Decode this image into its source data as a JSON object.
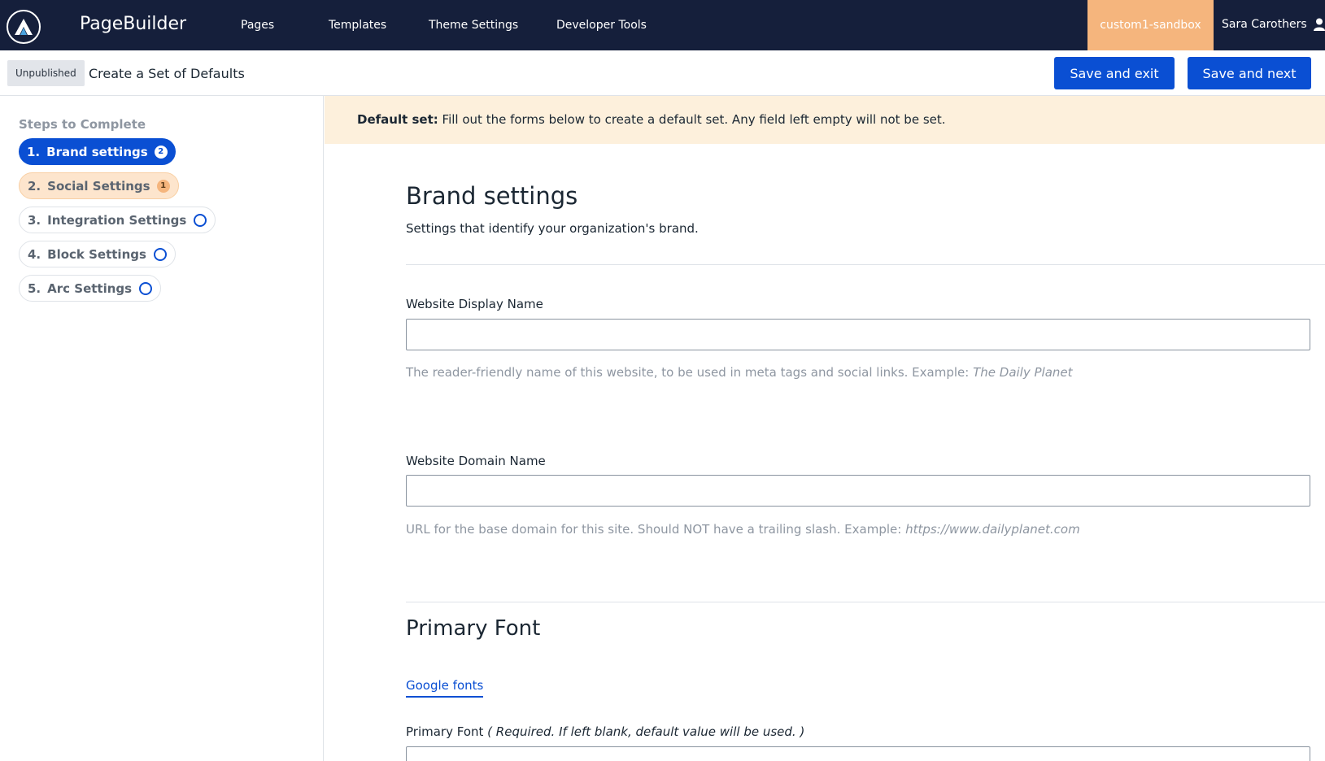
{
  "nav": {
    "app_name": "PageBuilder",
    "links": [
      "Pages",
      "Templates",
      "Theme Settings",
      "Developer Tools"
    ],
    "environment": "custom1-sandbox",
    "user_name": "Sara Carothers",
    "bg_color": "#151f3b"
  },
  "subheader": {
    "status": "Unpublished",
    "title": "Create a Set of Defaults",
    "save_exit_label": "Save and exit",
    "save_next_label": "Save and next"
  },
  "sidebar": {
    "title": "Steps to Complete",
    "steps": [
      {
        "num": "1.",
        "label": "Brand settings",
        "badge": "2",
        "state": "active"
      },
      {
        "num": "2.",
        "label": "Social Settings",
        "badge": "1",
        "state": "warning"
      },
      {
        "num": "3.",
        "label": "Integration Settings",
        "badge": "",
        "state": "todo"
      },
      {
        "num": "4.",
        "label": "Block Settings",
        "badge": "",
        "state": "todo"
      },
      {
        "num": "5.",
        "label": "Arc Settings",
        "badge": "",
        "state": "todo"
      }
    ]
  },
  "notice": {
    "label": "Default set:",
    "text": "Fill out the forms below to create a default set. Any field left empty will not be set."
  },
  "brand": {
    "title": "Brand settings",
    "subtitle": "Settings that identify your organization's brand.",
    "fields": [
      {
        "label": "Website Display Name",
        "value": "",
        "help": "The reader-friendly name of this website, to be used in meta tags and social links. Example:",
        "example": "The Daily Planet"
      },
      {
        "label": "Website Domain Name",
        "value": "",
        "help": "URL for the base domain for this site. Should NOT have a trailing slash. Example:",
        "example": "https://www.dailyplanet.com"
      }
    ]
  },
  "primary_font": {
    "title": "Primary Font",
    "tab": "Google fonts",
    "field_label": "Primary Font",
    "field_note": "( Required. If left blank, default value will be used. )"
  },
  "colors": {
    "accent": "#0a4fd3",
    "env_badge": "#f5b57d",
    "notice_bg": "#fdf0dc"
  }
}
